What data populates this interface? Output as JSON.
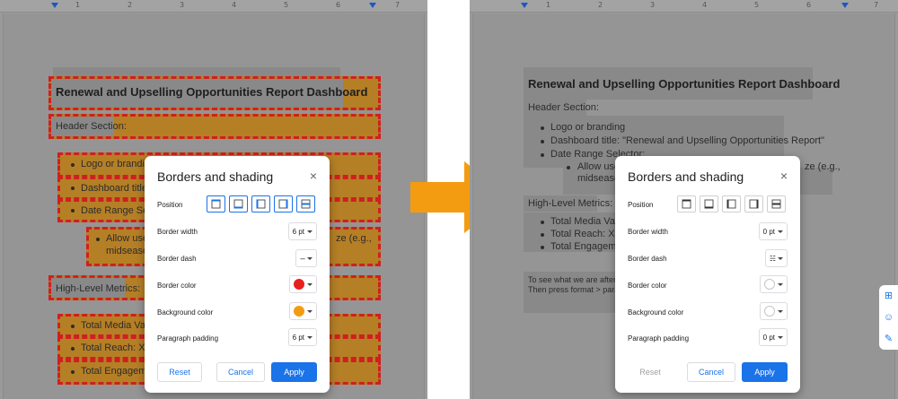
{
  "arrow_color": "#f39c12",
  "document": {
    "title": "Renewal and Upselling Opportunities Report Dashboard",
    "header_section": "Header Section:",
    "bullets_header": [
      "Logo or branding",
      "Dashboard title: \"Renewal and Upselling Opportunities Report\"",
      "Date Range Selector:"
    ],
    "sub_bullet_line1": "Allow users",
    "sub_bullet_line1_end": "ze (e.g.,",
    "sub_bullet_line2": "midseason",
    "high_level": "High-Level Metrics:",
    "bullets_metrics": [
      "Total Media Value",
      "Total Reach: XXXX",
      "Total Engagement"
    ],
    "left_truncated": {
      "bullets_header": [
        "Logo or branding",
        "Dashboard title: \"",
        "Date Range Select"
      ],
      "sub_line1": "Allow users",
      "sub_line2": "midseason",
      "metrics": [
        "Total Media Value",
        "Total Reach: XXXX",
        "Total Engagement"
      ]
    },
    "right_truncated": {
      "sub_line1": "Allow users",
      "sub_line2": "midseason)",
      "metrics": [
        "Total Media Value",
        "Total Reach: XXXX",
        "Total Engagement"
      ],
      "note1": "To see what we are after pl",
      "note2": "Then press format > paragra"
    }
  },
  "left_dialog": {
    "title": "Borders and shading",
    "close": "×",
    "position_label": "Position",
    "border_width_label": "Border width",
    "border_width_value": "6 pt",
    "border_dash_label": "Border dash",
    "border_dash_value": "---",
    "border_color_label": "Border color",
    "border_color": "#e8201c",
    "background_color_label": "Background color",
    "background_color": "#f39c12",
    "padding_label": "Paragraph padding",
    "padding_value": "6 pt",
    "reset": "Reset",
    "cancel": "Cancel",
    "apply": "Apply"
  },
  "right_dialog": {
    "title": "Borders and shading",
    "close": "×",
    "position_label": "Position",
    "border_width_label": "Border width",
    "border_width_value": "0 pt",
    "border_dash_label": "Border dash",
    "border_dash_value": "☵",
    "border_color_label": "Border color",
    "border_color": "#ffffff",
    "background_color_label": "Background color",
    "background_color": "#ffffff",
    "padding_label": "Paragraph padding",
    "padding_value": "0 pt",
    "reset": "Reset",
    "cancel": "Cancel",
    "apply": "Apply"
  },
  "ruler": {
    "numbers": [
      "1",
      "2",
      "3",
      "4",
      "5",
      "6",
      "7"
    ]
  },
  "side_icons": [
    "add-comment-icon",
    "emoji-icon",
    "suggest-edit-icon"
  ]
}
